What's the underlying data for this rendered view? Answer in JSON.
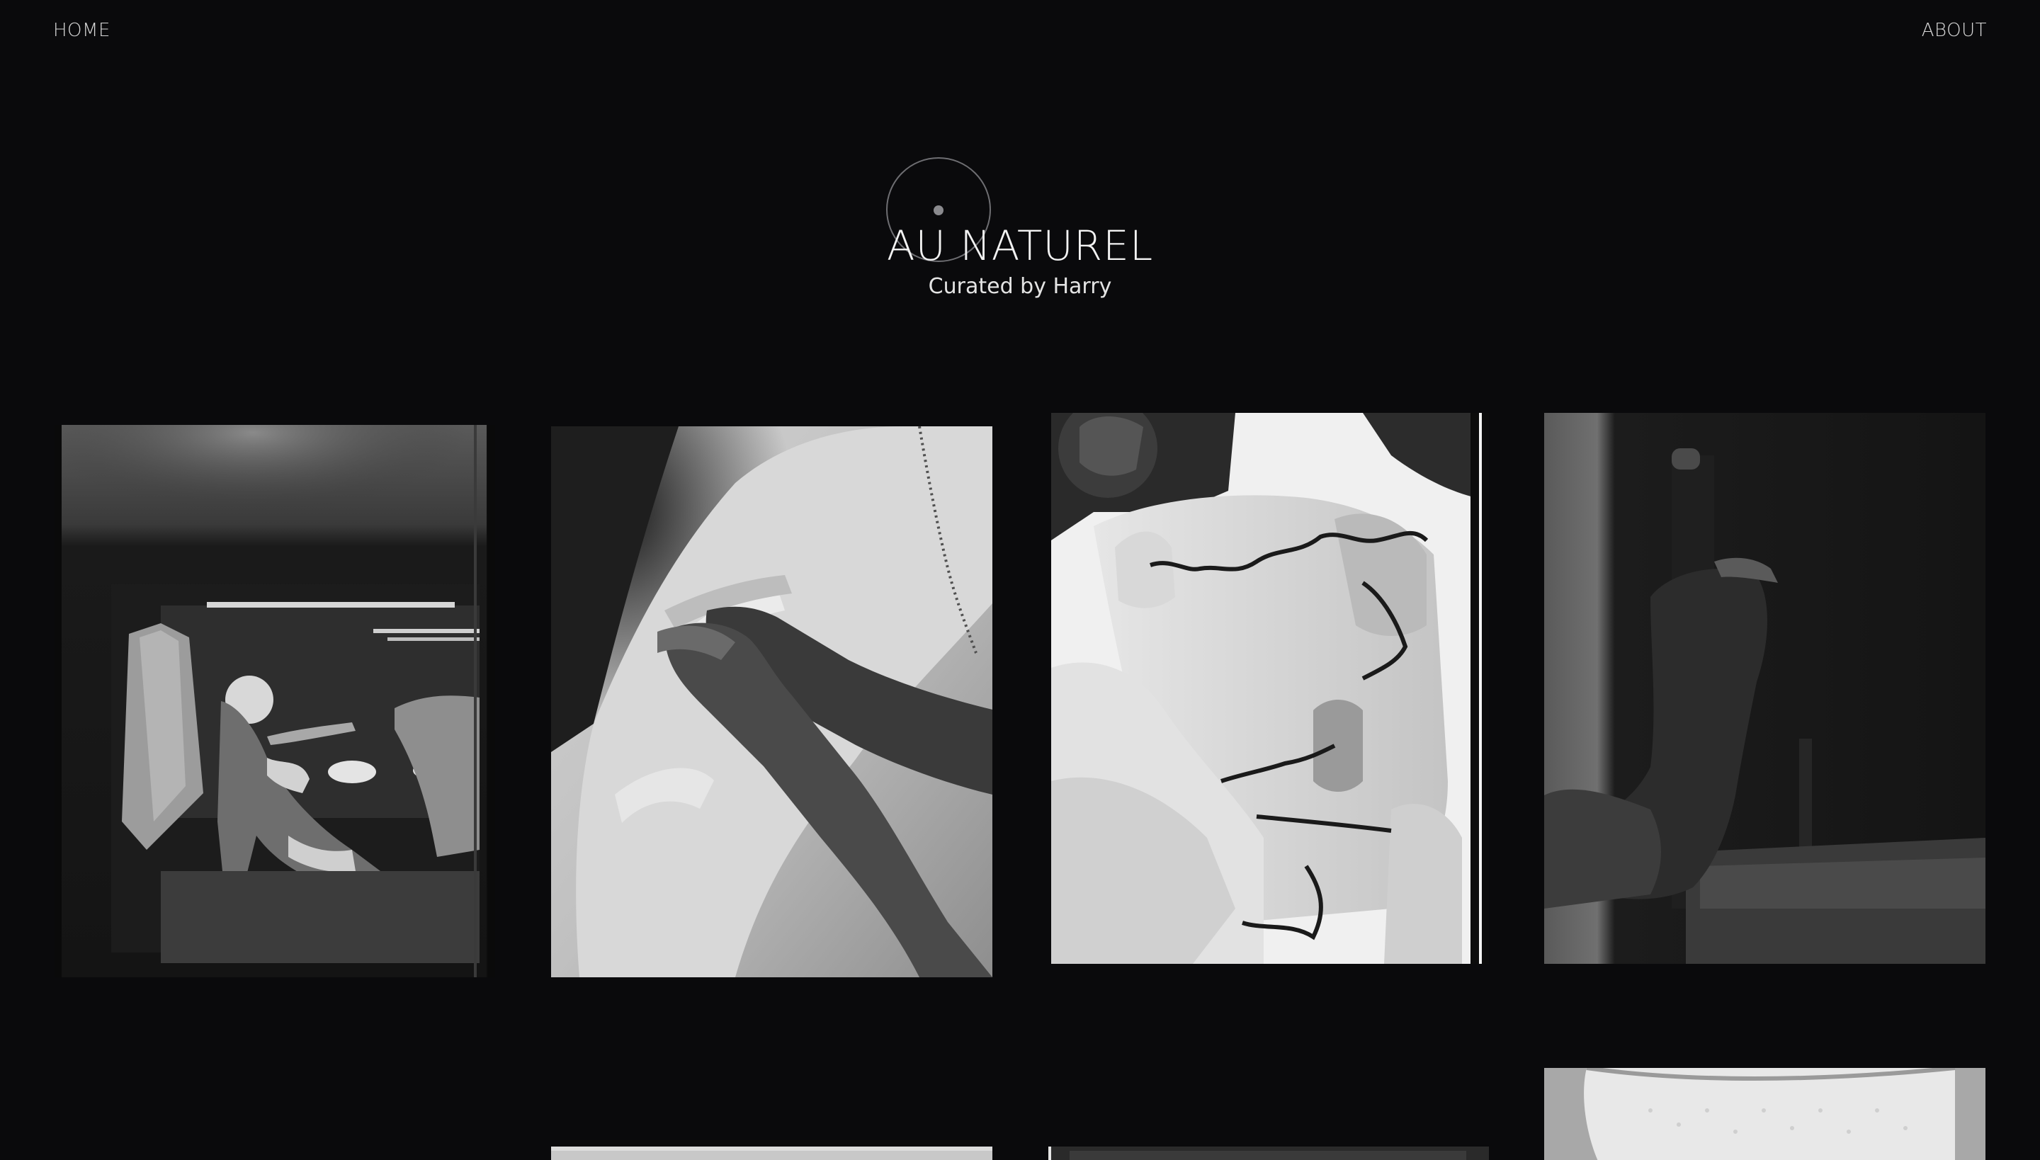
{
  "nav": {
    "home_label": "HOME",
    "about_label": "ABOUT"
  },
  "hero": {
    "title": "AU NATUREL",
    "subtitle": "Curated by Harry"
  },
  "colors": {
    "background": "#0a0a0c",
    "text": "#f2f2f2",
    "cursor_ring": "#6e6e72"
  },
  "gallery": {
    "photos": [
      {
        "icon": "photo-bathroom-mirror"
      },
      {
        "icon": "photo-hands-on-sheet"
      },
      {
        "icon": "photo-painted-lines-body"
      },
      {
        "icon": "photo-knee-shadow"
      },
      {
        "icon": "photo-row2-col2"
      },
      {
        "icon": "photo-row2-col3"
      },
      {
        "icon": "photo-row2-col4"
      }
    ]
  }
}
